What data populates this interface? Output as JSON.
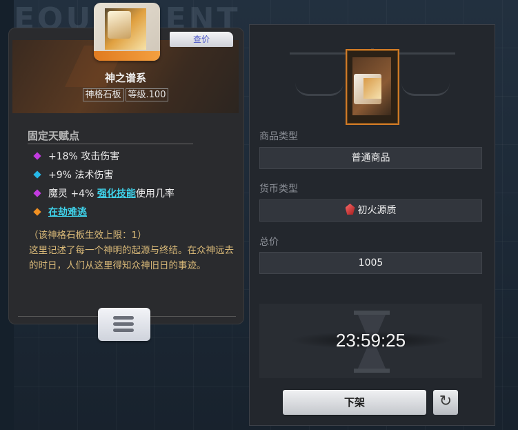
{
  "background": {
    "title": "EQUIPMENT"
  },
  "item_card": {
    "price_check_label": "查价",
    "name": "神之谱系",
    "tags": [
      "神格石板",
      "等级.100"
    ],
    "fixed_talent_title": "固定天赋点",
    "talents": [
      {
        "text": "+18% 攻击伤害",
        "color": "purple"
      },
      {
        "text": "+9% 法术伤害",
        "color": "blue"
      },
      {
        "prefix": "魔灵 +4% ",
        "link": "强化技能",
        "suffix": "使用几率",
        "color": "purple"
      },
      {
        "link": "在劫难逃",
        "color": "orange"
      }
    ],
    "limit_text": "（该神格石板生效上限：1）",
    "description": "这里记述了每一个神明的起源与终结。在众神远去的时日，人们从这里得知众神旧日的事迹。"
  },
  "right_panel": {
    "item_type_label": "商品类型",
    "item_type_value": "普通商品",
    "currency_label": "货币类型",
    "currency_value": "初火源质",
    "total_label": "总价",
    "total_value": "1005",
    "timer": "23:59:25",
    "delist_label": "下架",
    "refresh_icon": "↻"
  },
  "colors": {
    "accent_orange": "#e07b20",
    "talent_purple": "#c23be0",
    "talent_blue": "#26b8e8",
    "talent_orange": "#f19022",
    "link_cyan": "#3fd2ea",
    "description_gold": "#d9b978"
  }
}
